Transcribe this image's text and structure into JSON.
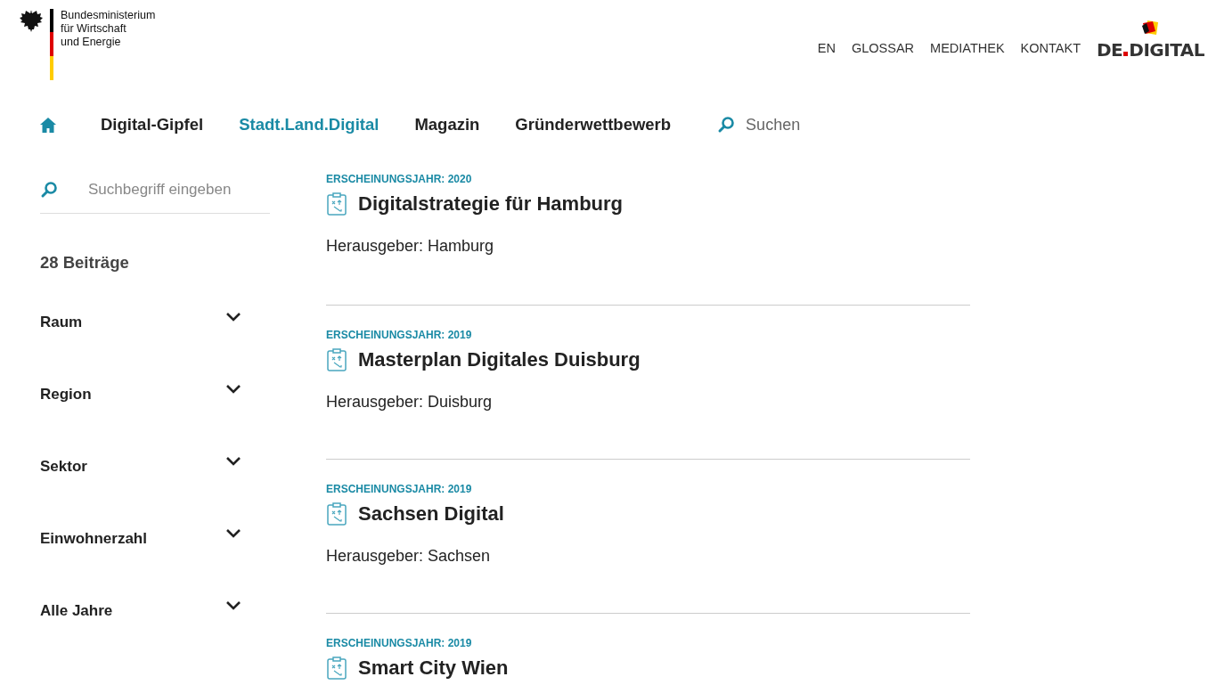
{
  "ministry_logo": {
    "lines": [
      "Bundesministerium",
      "für Wirtschaft",
      "und Energie"
    ]
  },
  "top_links": [
    "EN",
    "GLOSSAR",
    "MEDIATHEK",
    "KONTAKT"
  ],
  "brand_logo": {
    "parts": [
      "DE",
      "DIGITAL"
    ]
  },
  "main_nav": [
    {
      "label": "Digital-Gipfel",
      "selected": false
    },
    {
      "label": "Stadt.Land.Digital",
      "selected": true
    },
    {
      "label": "Magazin",
      "selected": false
    },
    {
      "label": "Gründerwettbewerb",
      "selected": false
    }
  ],
  "nav_search": {
    "placeholder": "Suchen"
  },
  "sidebar": {
    "search": {
      "placeholder": "Suchbegriff eingeben"
    },
    "count": "28 Beiträge",
    "filters": [
      {
        "label": "Raum",
        "expanded": false
      },
      {
        "label": "Region",
        "expanded": false
      },
      {
        "label": "Sektor",
        "expanded": false
      },
      {
        "label": "Einwohnerzahl",
        "expanded": false
      },
      {
        "label": "Alle Jahre",
        "expanded": false
      }
    ]
  },
  "results": [
    {
      "year": "ERSCHEINUNGSJAHR: 2020",
      "title": "Digitalstrategie für Hamburg",
      "publisher": "Herausgeber: Hamburg"
    },
    {
      "year": "ERSCHEINUNGSJAHR: 2019",
      "title": "Masterplan Digitales Duisburg",
      "publisher": "Herausgeber: Duisburg"
    },
    {
      "year": "ERSCHEINUNGSJAHR: 2019",
      "title": "Sachsen Digital",
      "publisher": "Herausgeber: Sachsen"
    },
    {
      "year": "ERSCHEINUNGSJAHR: 2019",
      "title": "Smart City Wien"
    }
  ]
}
